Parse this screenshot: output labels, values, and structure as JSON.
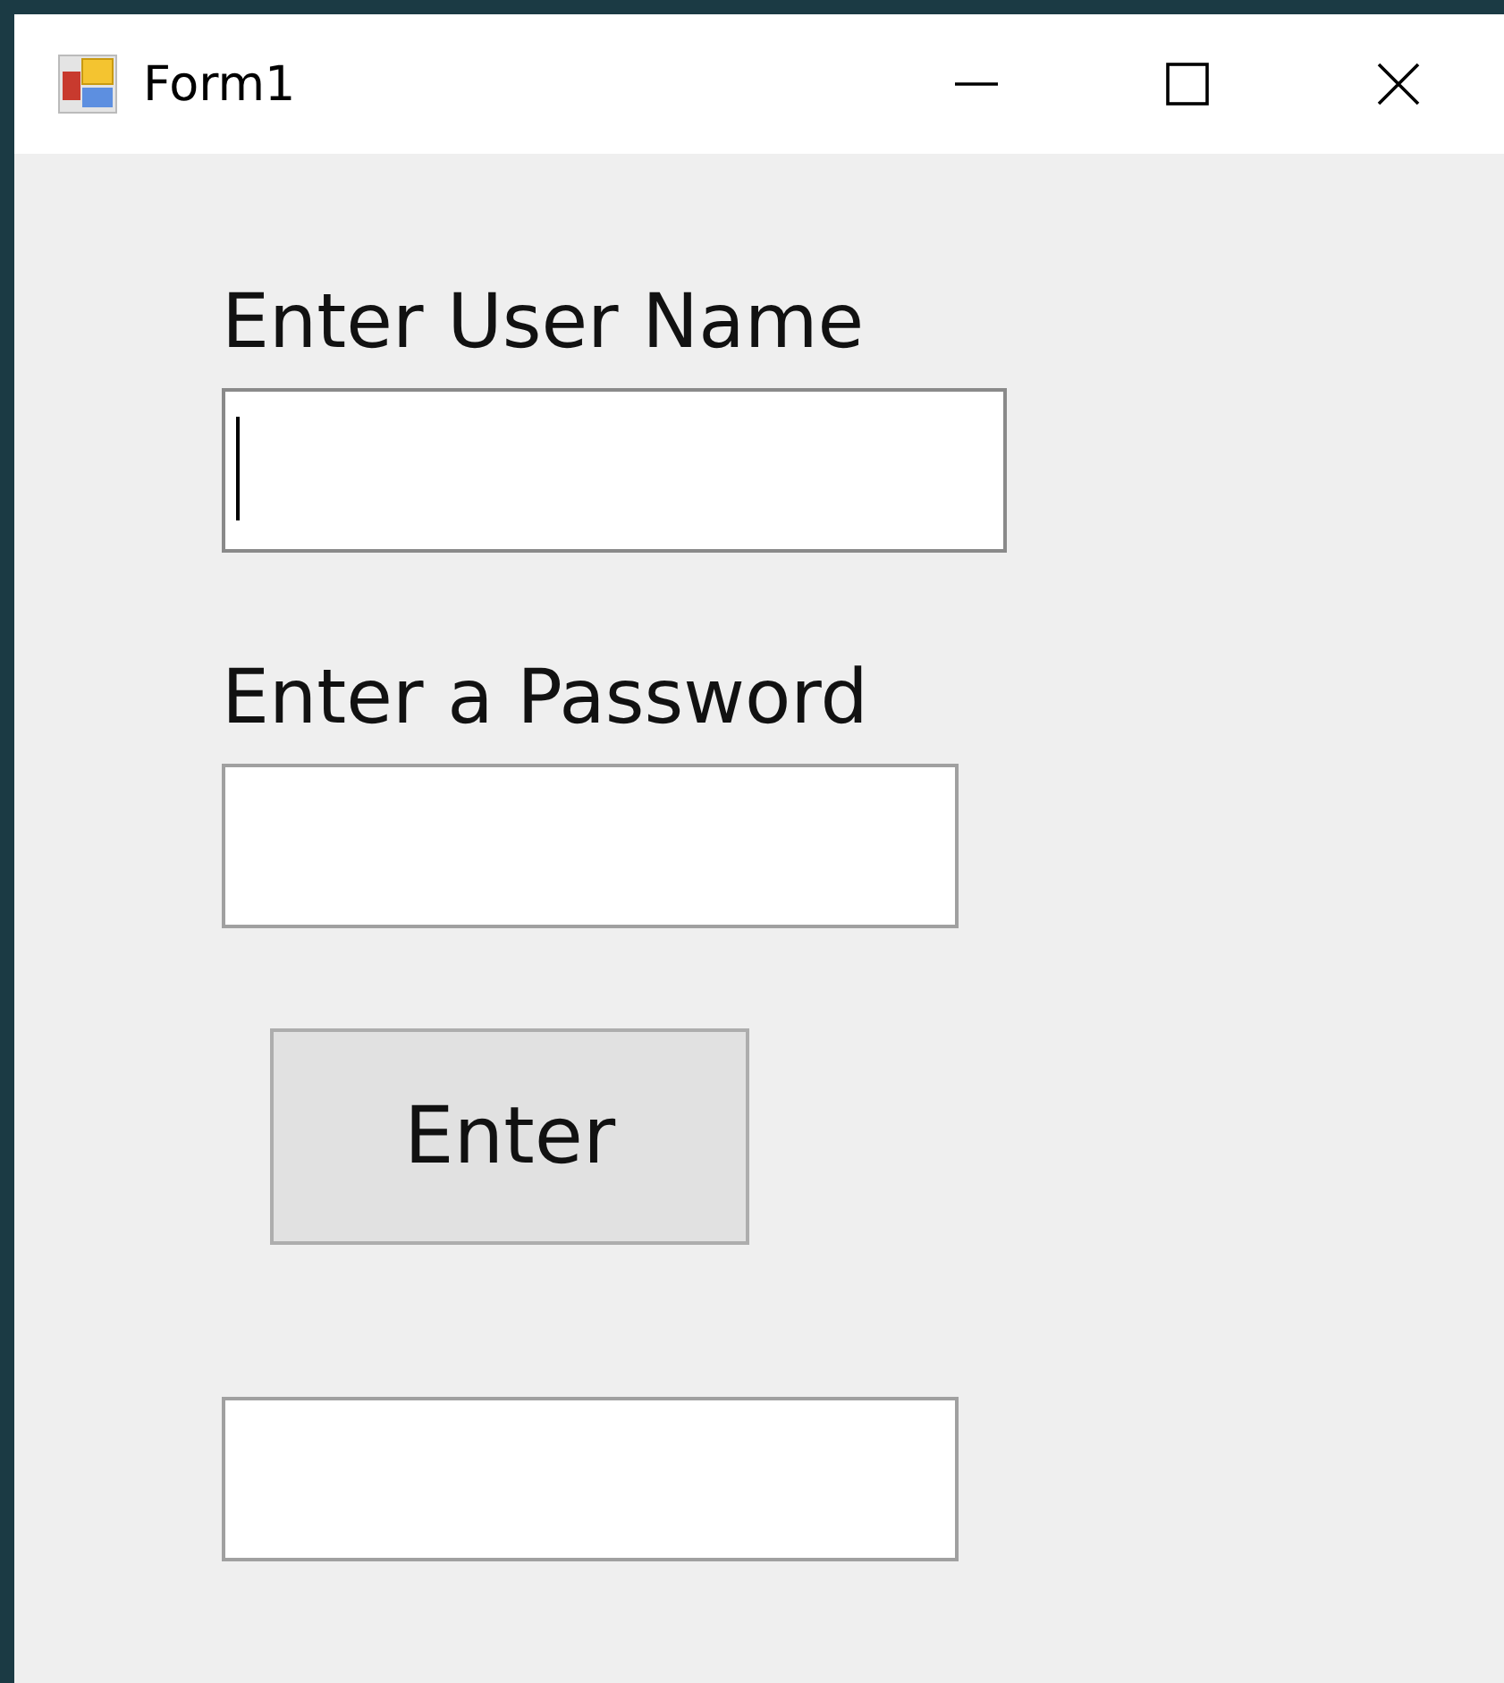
{
  "window": {
    "title": "Form1"
  },
  "fields": [
    {
      "label": "Enter User Name",
      "focused": true
    },
    {
      "label": "Enter a Password",
      "focused": false
    }
  ],
  "button": {
    "label": "Enter"
  },
  "output_field": {
    "focused": false
  }
}
